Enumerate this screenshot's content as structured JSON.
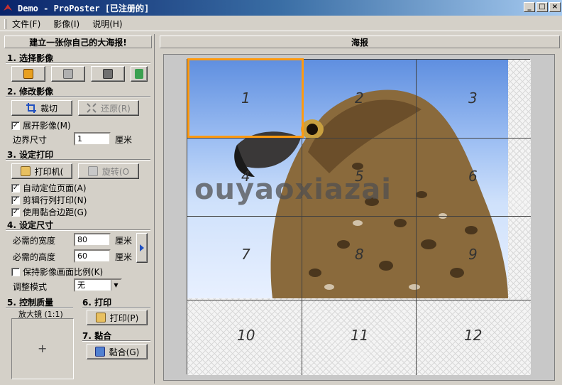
{
  "window": {
    "title": "Demo - ProPoster [已注册的]",
    "min": "_",
    "max": "□",
    "close": "×"
  },
  "menu": [
    "文件(F)",
    "影像(I)",
    "说明(H)"
  ],
  "left": {
    "header": "建立一张你自己的大海报!",
    "s1": "1. 选择影像",
    "s2": "2. 修改影像",
    "crop": "裁切",
    "restore": "还原(R)",
    "expand": "展开影像(M)",
    "border_label": "边界尺寸",
    "border_value": "1",
    "border_unit": "厘米",
    "s3": "3. 设定打印",
    "printer": "打印机(",
    "rotate": "旋转(O",
    "auto_pos": "自动定位页面(A)",
    "cut_print": "剪辑行列打印(N)",
    "use_glue": "使用黏合边距(G)",
    "s4": "4. 设定尺寸",
    "width_label": "必需的宽度",
    "width_value": "80",
    "width_unit": "厘米",
    "height_label": "必需的高度",
    "height_value": "60",
    "height_unit": "厘米",
    "keep_ratio": "保持影像画面比例(K)",
    "adjust_label": "调整模式",
    "adjust_value": "无",
    "s5": "5. 控制质量",
    "magnifier": "放大镜 (1:1)",
    "cross": "+",
    "s6": "6. 打印",
    "print": "打印(P)",
    "s7": "7. 黏合",
    "glue": "黏合(G)"
  },
  "right": {
    "header": "海报",
    "cells": [
      "1",
      "2",
      "3",
      "4",
      "5",
      "6",
      "7",
      "8",
      "9",
      "10",
      "11",
      "12"
    ],
    "watermark": "ouyaoxiazai"
  }
}
